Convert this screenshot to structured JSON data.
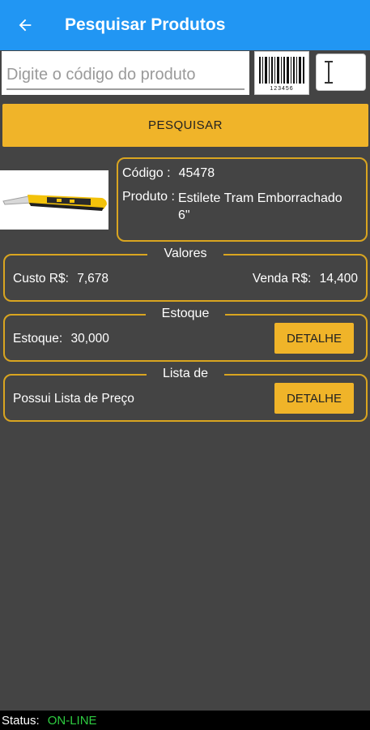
{
  "appbar": {
    "title": "Pesquisar Produtos",
    "back_icon": "arrow-left-icon"
  },
  "search": {
    "placeholder": "Digite o código do produto",
    "value": "",
    "barcode_digits": "123456"
  },
  "search_button": {
    "label": "PESQUISAR"
  },
  "product": {
    "code_label": "Código :",
    "code_value": "45478",
    "name_label": "Produto :",
    "name_value": "Estilete Tram Emborrachado 6\""
  },
  "valores": {
    "title": "Valores",
    "custo_label": "Custo R$:",
    "custo_value": "7,678",
    "venda_label": "Venda R$:",
    "venda_value": "14,400"
  },
  "estoque": {
    "title": "Estoque",
    "label": "Estoque:",
    "value": "30,000",
    "button": "DETALHE"
  },
  "lista": {
    "title": "Lista de",
    "text": "Possui Lista de Preço",
    "button": "DETALHE"
  },
  "status": {
    "label": "Status:",
    "value": "ON-LINE"
  },
  "colors": {
    "appbar": "#2196f3",
    "accent": "#f0b429",
    "background": "#444444",
    "online": "#2ecc40"
  }
}
